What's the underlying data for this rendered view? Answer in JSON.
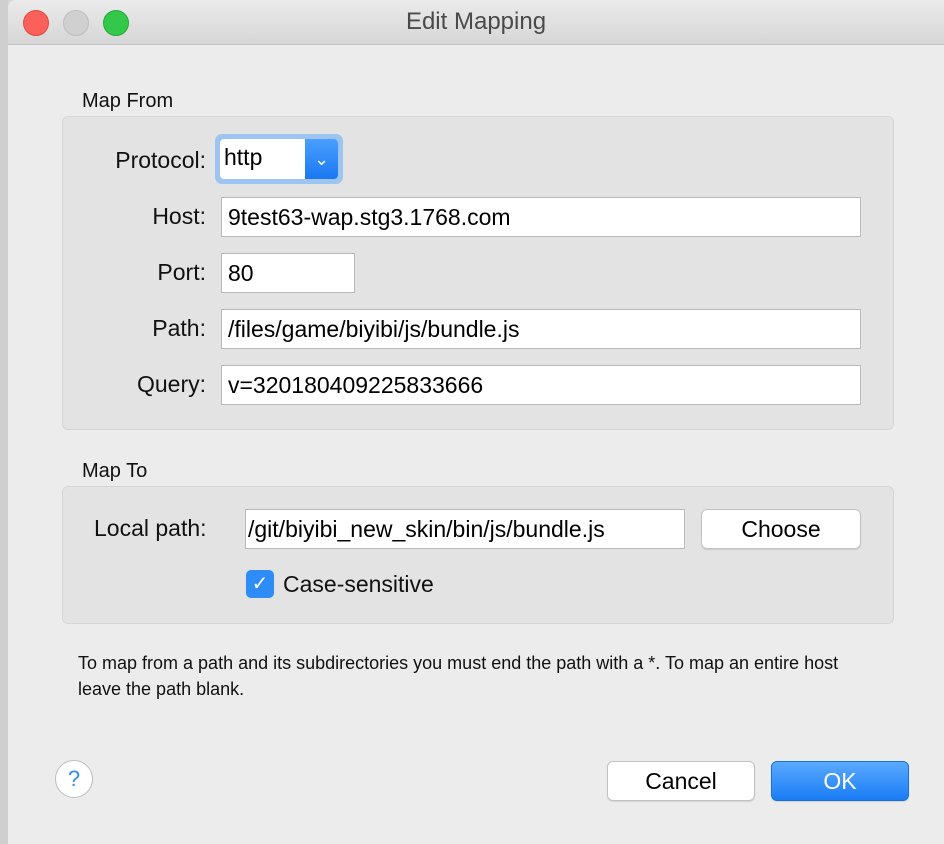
{
  "window": {
    "title": "Edit Mapping"
  },
  "map_from": {
    "heading": "Map From",
    "protocol_label": "Protocol:",
    "protocol_value": "http",
    "host_label": "Host:",
    "host_value": "9test63-wap.stg3.1768.com",
    "port_label": "Port:",
    "port_value": "80",
    "path_label": "Path:",
    "path_value": "/files/game/biyibi/js/bundle.js",
    "query_label": "Query:",
    "query_value": "v=320180409225833666"
  },
  "map_to": {
    "heading": "Map To",
    "local_path_label": "Local path:",
    "local_path_value": "/git/biyibi_new_skin/bin/js/bundle.js",
    "choose_label": "Choose",
    "case_sensitive_label": "Case-sensitive",
    "case_sensitive_checked": true
  },
  "hint": "To map from a path and its subdirectories you must end the path with a *. To map an entire host leave the path blank.",
  "buttons": {
    "help": "?",
    "cancel": "Cancel",
    "ok": "OK"
  },
  "colors": {
    "accent": "#1a82fb",
    "close": "#fc605b",
    "zoom": "#34c84a"
  }
}
